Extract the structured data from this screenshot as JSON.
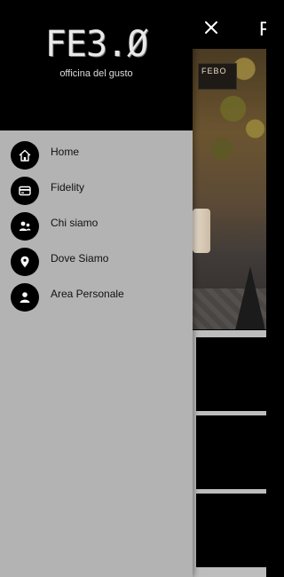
{
  "app": {
    "background_title": "F",
    "close_icon": "close-icon"
  },
  "logo": {
    "main": "FE3.Ø",
    "sub": "officina del gusto"
  },
  "hero": {
    "sign_text": "FEBO"
  },
  "menu": {
    "items": [
      {
        "label": "Home",
        "icon": "home-icon"
      },
      {
        "label": "Fidelity",
        "icon": "card-icon"
      },
      {
        "label": "Chi siamo",
        "icon": "people-icon"
      },
      {
        "label": "Dove Siamo",
        "icon": "location-pin-icon"
      },
      {
        "label": "Area Personale",
        "icon": "person-icon"
      }
    ]
  },
  "colors": {
    "drawer_bg": "#b3b3b3",
    "header_bg": "#000000",
    "icon_bg": "#000000",
    "label_text": "#111111"
  }
}
